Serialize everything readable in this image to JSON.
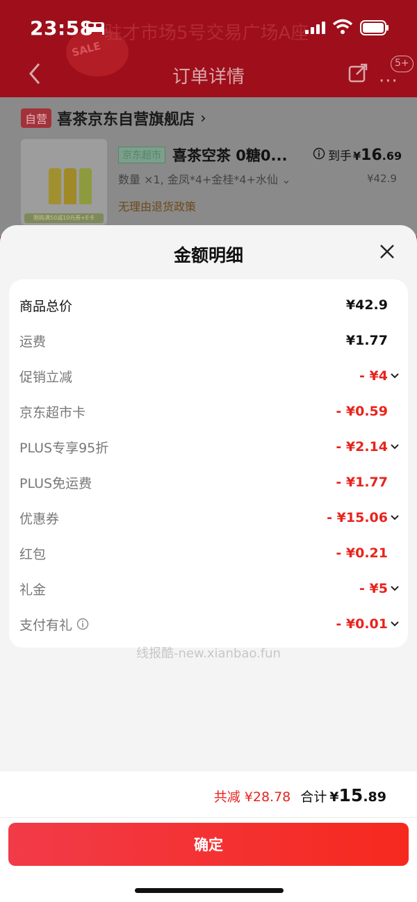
{
  "status_bar": {
    "time": "23:58"
  },
  "nav": {
    "title": "订单详情",
    "more": "···",
    "badge": "5+"
  },
  "background": {
    "header_text": "驻才市场5号交易广场A座",
    "header_text2": "SALE"
  },
  "store": {
    "tag": "自营",
    "name": "喜茶京东自营旗舰店",
    "chevron": "›"
  },
  "product": {
    "jd_tag": "京东超市",
    "name": "喜茶空茶 0糖0...",
    "price_label": "到手",
    "price_yen": "¥",
    "price_int": "16",
    "price_dec": ".69",
    "spec": "数量 ×1, 金凤*4+金桂*4+水仙 ⌄",
    "original_price": "¥42.9",
    "refund_policy": "无理由退货政策",
    "img_tag": "限购满50减10元券+E卡"
  },
  "sheet": {
    "title": "金额明细",
    "rows": [
      {
        "label": "商品总价",
        "amount": "¥42.9"
      },
      {
        "label": "运费",
        "amount": "¥1.77"
      },
      {
        "label": "促销立减",
        "amount": "- ¥4"
      },
      {
        "label": "京东超市卡",
        "amount": "- ¥0.59"
      },
      {
        "label": "PLUS专享95折",
        "amount": "- ¥2.14"
      },
      {
        "label": "PLUS免运费",
        "amount": "- ¥1.77"
      },
      {
        "label": "优惠券",
        "amount": "- ¥15.06"
      },
      {
        "label": "红包",
        "amount": "- ¥0.21"
      },
      {
        "label": "礼金",
        "amount": "- ¥5"
      },
      {
        "label": "支付有礼",
        "amount": "- ¥0.01"
      }
    ],
    "watermark": "线报酷-new.xianbao.fun"
  },
  "footer": {
    "total_reduce": "共减 ¥28.78",
    "total_label": "合计",
    "total_yen": "¥",
    "total_int": "15",
    "total_dec": ".89",
    "confirm_label": "确定"
  },
  "colors": {
    "accent_red": "#e8231c",
    "header_red": "#9e0f1b",
    "button_start": "#f13b48",
    "button_end": "#f6291e"
  }
}
